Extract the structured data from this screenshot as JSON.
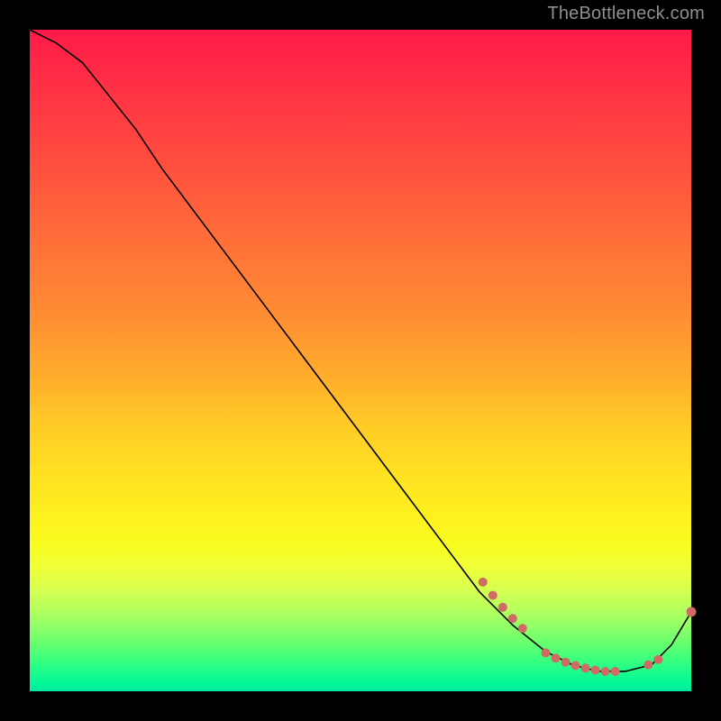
{
  "watermark": "TheBottleneck.com",
  "chart_data": {
    "type": "line",
    "title": "",
    "xlabel": "",
    "ylabel": "",
    "xlim": [
      0,
      100
    ],
    "ylim": [
      0,
      100
    ],
    "series": [
      {
        "name": "bottleneck-curve",
        "x": [
          0,
          4,
          8,
          12,
          16,
          20,
          26,
          32,
          38,
          44,
          50,
          56,
          62,
          68,
          73,
          78,
          82,
          86,
          90,
          94,
          97,
          100
        ],
        "y": [
          100,
          98,
          95,
          90,
          85,
          79,
          71,
          63,
          55,
          47,
          39,
          31,
          23,
          15,
          10,
          6,
          4,
          3,
          3,
          4,
          7,
          12
        ]
      }
    ],
    "clusters": [
      {
        "name": "upper-cluster",
        "points": [
          {
            "x": 68.5,
            "y": 16.5
          },
          {
            "x": 70.0,
            "y": 14.5
          },
          {
            "x": 71.5,
            "y": 12.7
          },
          {
            "x": 73.0,
            "y": 11.0
          },
          {
            "x": 74.5,
            "y": 9.5
          }
        ]
      },
      {
        "name": "lower-cluster",
        "points": [
          {
            "x": 78.0,
            "y": 5.8
          },
          {
            "x": 79.5,
            "y": 5.0
          },
          {
            "x": 81.0,
            "y": 4.4
          },
          {
            "x": 82.5,
            "y": 3.9
          },
          {
            "x": 84.0,
            "y": 3.5
          },
          {
            "x": 85.5,
            "y": 3.2
          },
          {
            "x": 87.0,
            "y": 3.0
          },
          {
            "x": 88.5,
            "y": 3.0
          }
        ]
      },
      {
        "name": "tail-cluster",
        "points": [
          {
            "x": 93.5,
            "y": 4.0
          },
          {
            "x": 95.0,
            "y": 4.8
          }
        ]
      },
      {
        "name": "end-point",
        "points": [
          {
            "x": 100.0,
            "y": 12.0
          }
        ]
      }
    ],
    "label": {
      "text": "",
      "x": 83,
      "y": 3.5
    },
    "colors": {
      "curve": "#000000",
      "marker": "#cf6a64",
      "gradient_top": "#ff1a48",
      "gradient_mid": "#ffe322",
      "gradient_bottom": "#00f79a"
    }
  }
}
